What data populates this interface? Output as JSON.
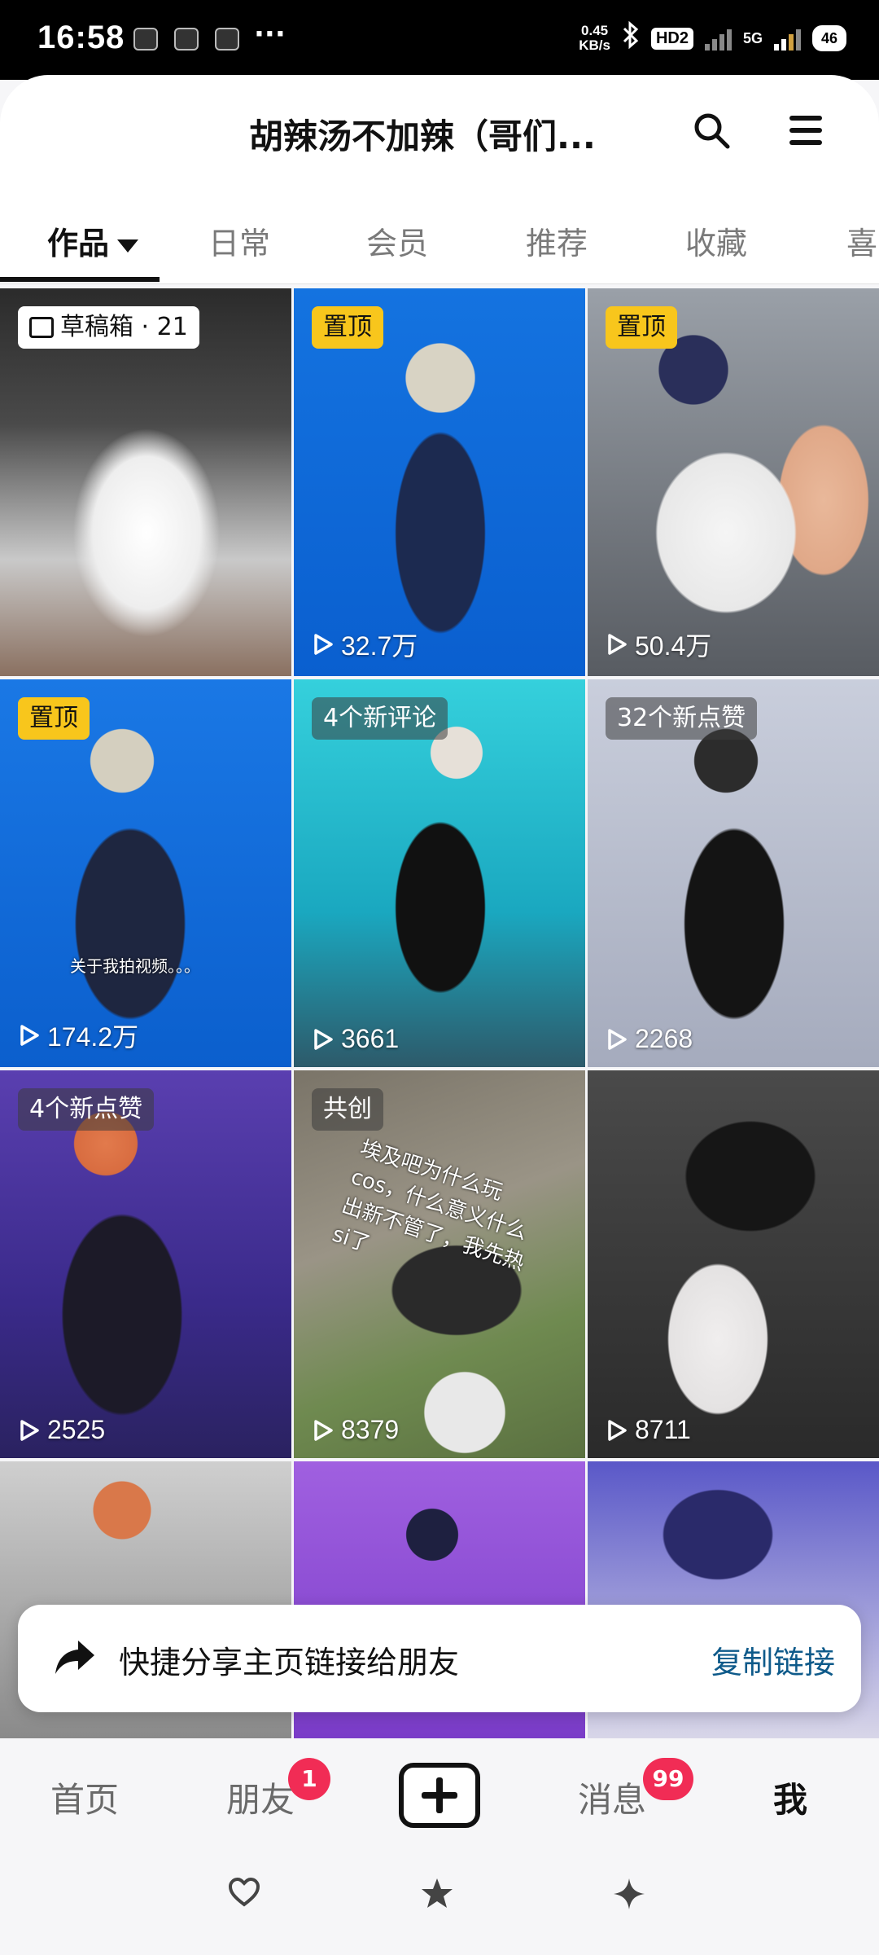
{
  "status_bar": {
    "time": "16:58",
    "net_speed_value": "0.45",
    "net_speed_unit": "KB/s",
    "hd": "HD2",
    "net_type": "5G",
    "battery": "46",
    "more": "···"
  },
  "header": {
    "title": "胡辣汤不加辣（哥们...",
    "search_icon": "search-icon",
    "menu_icon": "menu-icon"
  },
  "tabs": [
    {
      "label": "作品"
    },
    {
      "label": "日常"
    },
    {
      "label": "会员"
    },
    {
      "label": "推荐"
    },
    {
      "label": "收藏"
    },
    {
      "label": "喜"
    }
  ],
  "videos": [
    {
      "badge": "草稿箱 · 21",
      "plays": ""
    },
    {
      "badge": "置顶",
      "plays": "32.7万"
    },
    {
      "badge": "置顶",
      "plays": "50.4万"
    },
    {
      "badge": "置顶",
      "plays": "174.2万",
      "caption": "关于我拍视频。。。"
    },
    {
      "badge": "4个新评论",
      "plays": "3661"
    },
    {
      "badge": "32个新点赞",
      "plays": "2268"
    },
    {
      "badge": "4个新点赞",
      "plays": "2525"
    },
    {
      "badge": "共创",
      "plays": "8379",
      "caption": "埃及吧为什么玩cos，什么意义什么出新不管了，我先热si了"
    },
    {
      "badge": "",
      "plays": "8711"
    }
  ],
  "share_banner": {
    "text": "快捷分享主页链接给朋友",
    "action": "复制链接"
  },
  "bottom_nav": {
    "home": "首页",
    "friends": "朋友",
    "friends_badge": "1",
    "messages": "消息",
    "messages_badge": "99",
    "me": "我"
  },
  "colors": {
    "pin_badge": "#f8c61c",
    "nav_badge": "#f12c55",
    "link": "#0e5a8a"
  }
}
